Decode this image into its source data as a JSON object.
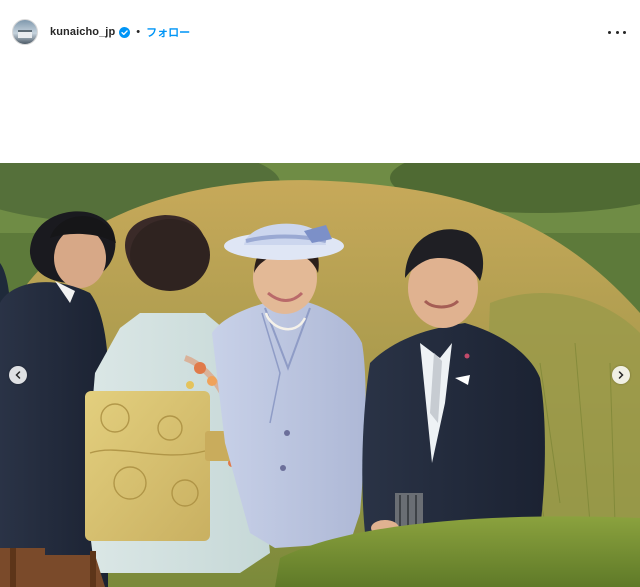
{
  "post": {
    "username": "kunaicho_jp",
    "verified": true,
    "separator": "•",
    "follow_label": "フォロー"
  },
  "icons": {
    "avatar": "palace-building-avatar",
    "verified": "verified-badge-icon",
    "more": "more-options-icon",
    "prev": "chevron-left-icon",
    "next": "chevron-right-icon"
  },
  "colors": {
    "follow": "#0095f6",
    "verified": "#0095f6",
    "text": "#262626"
  }
}
